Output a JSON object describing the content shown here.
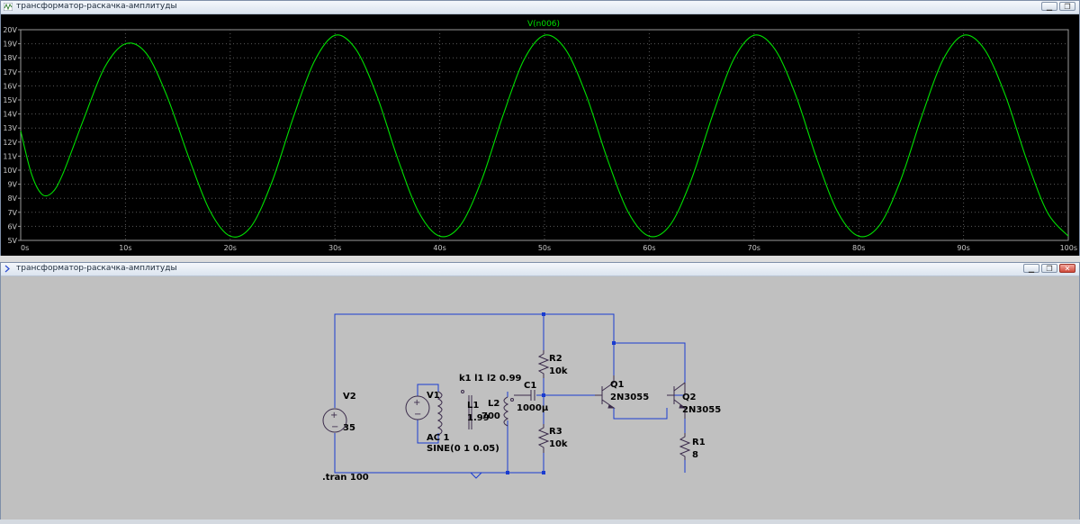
{
  "plot_window": {
    "title": "трансформатор-раскачка-амплитуды",
    "controls": [
      "minimize-icon",
      "restore-icon"
    ]
  },
  "schematic_window": {
    "title": "трансформатор-раскачка-амплитуды",
    "controls": [
      "minimize-icon",
      "restore-icon",
      "close-icon"
    ]
  },
  "colors": {
    "trace": "#00e000",
    "plot_bg": "#000000",
    "grid": "#5a5a5a",
    "wire": "#1a3cd0",
    "component": "#5a2020",
    "schematic_bg": "#c0c0c0"
  },
  "chart_data": {
    "type": "line",
    "title": "V(n006)",
    "xlabel": "",
    "ylabel": "",
    "xlim": [
      0,
      100
    ],
    "ylim": [
      5,
      20
    ],
    "grid": true,
    "x_ticks": [
      "0s",
      "10s",
      "20s",
      "30s",
      "40s",
      "50s",
      "60s",
      "70s",
      "80s",
      "90s",
      "100s"
    ],
    "y_ticks": [
      "5V",
      "6V",
      "7V",
      "8V",
      "9V",
      "10V",
      "11V",
      "12V",
      "13V",
      "14V",
      "15V",
      "16V",
      "17V",
      "18V",
      "19V",
      "20V"
    ],
    "series": [
      {
        "name": "V(n006)",
        "x": [
          0,
          1,
          2,
          3,
          4,
          6,
          8,
          10,
          12,
          14,
          16,
          18,
          20,
          22,
          24,
          26,
          28,
          30,
          32,
          34,
          36,
          38,
          40,
          42,
          44,
          46,
          48,
          50,
          52,
          54,
          56,
          58,
          60,
          62,
          64,
          66,
          68,
          70,
          72,
          74,
          76,
          78,
          80,
          82,
          84,
          86,
          88,
          90,
          92,
          94,
          96,
          98,
          100
        ],
        "y": [
          12.8,
          9.8,
          8.3,
          8.4,
          9.7,
          13.6,
          17.3,
          19.0,
          18.3,
          15.2,
          11.0,
          7.2,
          5.3,
          6.0,
          9.2,
          13.7,
          17.7,
          19.6,
          18.6,
          15.3,
          10.8,
          7.0,
          5.3,
          6.1,
          9.3,
          13.8,
          17.8,
          19.6,
          18.6,
          15.3,
          10.8,
          7.0,
          5.3,
          6.1,
          9.3,
          13.8,
          17.8,
          19.6,
          18.6,
          15.3,
          10.8,
          7.0,
          5.3,
          6.1,
          9.3,
          13.8,
          17.8,
          19.6,
          18.6,
          15.3,
          10.8,
          7.0,
          5.3
        ]
      }
    ]
  },
  "schematic": {
    "v2": {
      "name": "V2",
      "value": "35"
    },
    "v1": {
      "name": "V1",
      "value": "AC 1",
      "sine": "SINE(0 1 0.05)"
    },
    "l1": {
      "name": "L1",
      "value": "1.99"
    },
    "l2": {
      "name": "L2",
      "value": "700"
    },
    "coupling": "k1 l1 l2 0.99",
    "c1": {
      "name": "C1",
      "value": "1000µ"
    },
    "r2": {
      "name": "R2",
      "value": "10k"
    },
    "r3": {
      "name": "R3",
      "value": "10k"
    },
    "r1": {
      "name": "R1",
      "value": "8"
    },
    "q1": {
      "name": "Q1",
      "model": "2N3055"
    },
    "q2": {
      "name": "Q2",
      "model": "2N3055"
    },
    "directive": ".tran 100"
  }
}
